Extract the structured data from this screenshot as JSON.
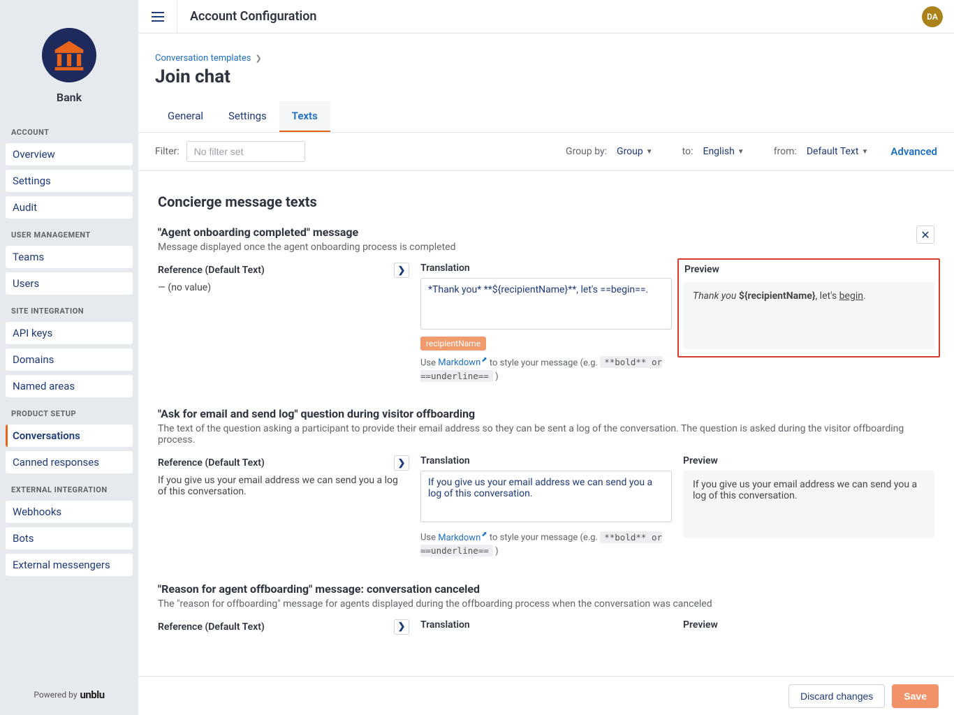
{
  "sidebar": {
    "brand_name": "Bank",
    "sections": {
      "account": {
        "title": "ACCOUNT",
        "items": [
          "Overview",
          "Settings",
          "Audit"
        ]
      },
      "user_mgmt": {
        "title": "USER MANAGEMENT",
        "items": [
          "Teams",
          "Users"
        ]
      },
      "site_int": {
        "title": "SITE INTEGRATION",
        "items": [
          "API keys",
          "Domains",
          "Named areas"
        ]
      },
      "product": {
        "title": "PRODUCT SETUP",
        "items": [
          "Conversations",
          "Canned responses"
        ]
      },
      "external": {
        "title": "EXTERNAL INTEGRATION",
        "items": [
          "Webhooks",
          "Bots",
          "External messengers"
        ]
      }
    },
    "powered_by": "Powered by",
    "powered_brand": "unblu"
  },
  "topbar": {
    "title": "Account Configuration",
    "avatar_initials": "DA"
  },
  "header": {
    "breadcrumb": "Conversation templates",
    "page_title": "Join chat",
    "tabs": [
      "General",
      "Settings",
      "Texts"
    ]
  },
  "filterbar": {
    "filter_label": "Filter:",
    "filter_placeholder": "No filter set",
    "group_by_label": "Group by:",
    "group_by_value": "Group",
    "to_label": "to:",
    "to_value": "English",
    "from_label": "from:",
    "from_value": "Default Text",
    "advanced": "Advanced"
  },
  "section_title": "Concierge message texts",
  "blocks": {
    "b1": {
      "title": "\"Agent onboarding completed\" message",
      "desc": "Message displayed once the agent onboarding process is completed",
      "ref_label": "Reference (Default Text)",
      "ref_value": "— (no value)",
      "trans_label": "Translation",
      "trans_value": "*Thank you* **${recipientName}**, let's ==begin==.",
      "chip": "recipientName",
      "hint_use": "Use ",
      "hint_md": "Markdown",
      "hint_rest": " to style your message (e.g. ",
      "hint_code": "**bold** or ==underline==",
      "hint_end": " )",
      "preview_label": "Preview",
      "preview_italic": "Thank you",
      "preview_bold": "${recipientName}",
      "preview_mid": ", let's ",
      "preview_uline": "begin",
      "preview_tail": "."
    },
    "b2": {
      "title": "\"Ask for email and send log\" question during visitor offboarding",
      "desc": "The text of the question asking a participant to provide their email address so they can be sent a log of the conversation. The question is asked during the visitor offboarding process.",
      "ref_label": "Reference (Default Text)",
      "ref_value": "If you give us your email address we can send you a log of this conversation.",
      "trans_label": "Translation",
      "trans_value": "If you give us your email address we can send you a log of this conversation.",
      "hint_use": "Use ",
      "hint_md": "Markdown",
      "hint_rest": " to style your message (e.g. ",
      "hint_code": "**bold** or ==underline==",
      "hint_end": " )",
      "preview_label": "Preview",
      "preview_text": "If you give us your email address we can send you a log of this conversation."
    },
    "b3": {
      "title": "\"Reason for agent offboarding\" message: conversation canceled",
      "desc": "The \"reason for offboarding\" message for agents displayed during the offboarding process when the conversation was canceled",
      "ref_label": "Reference (Default Text)",
      "trans_label": "Translation",
      "preview_label": "Preview"
    }
  },
  "footer": {
    "discard": "Discard changes",
    "save": "Save"
  }
}
